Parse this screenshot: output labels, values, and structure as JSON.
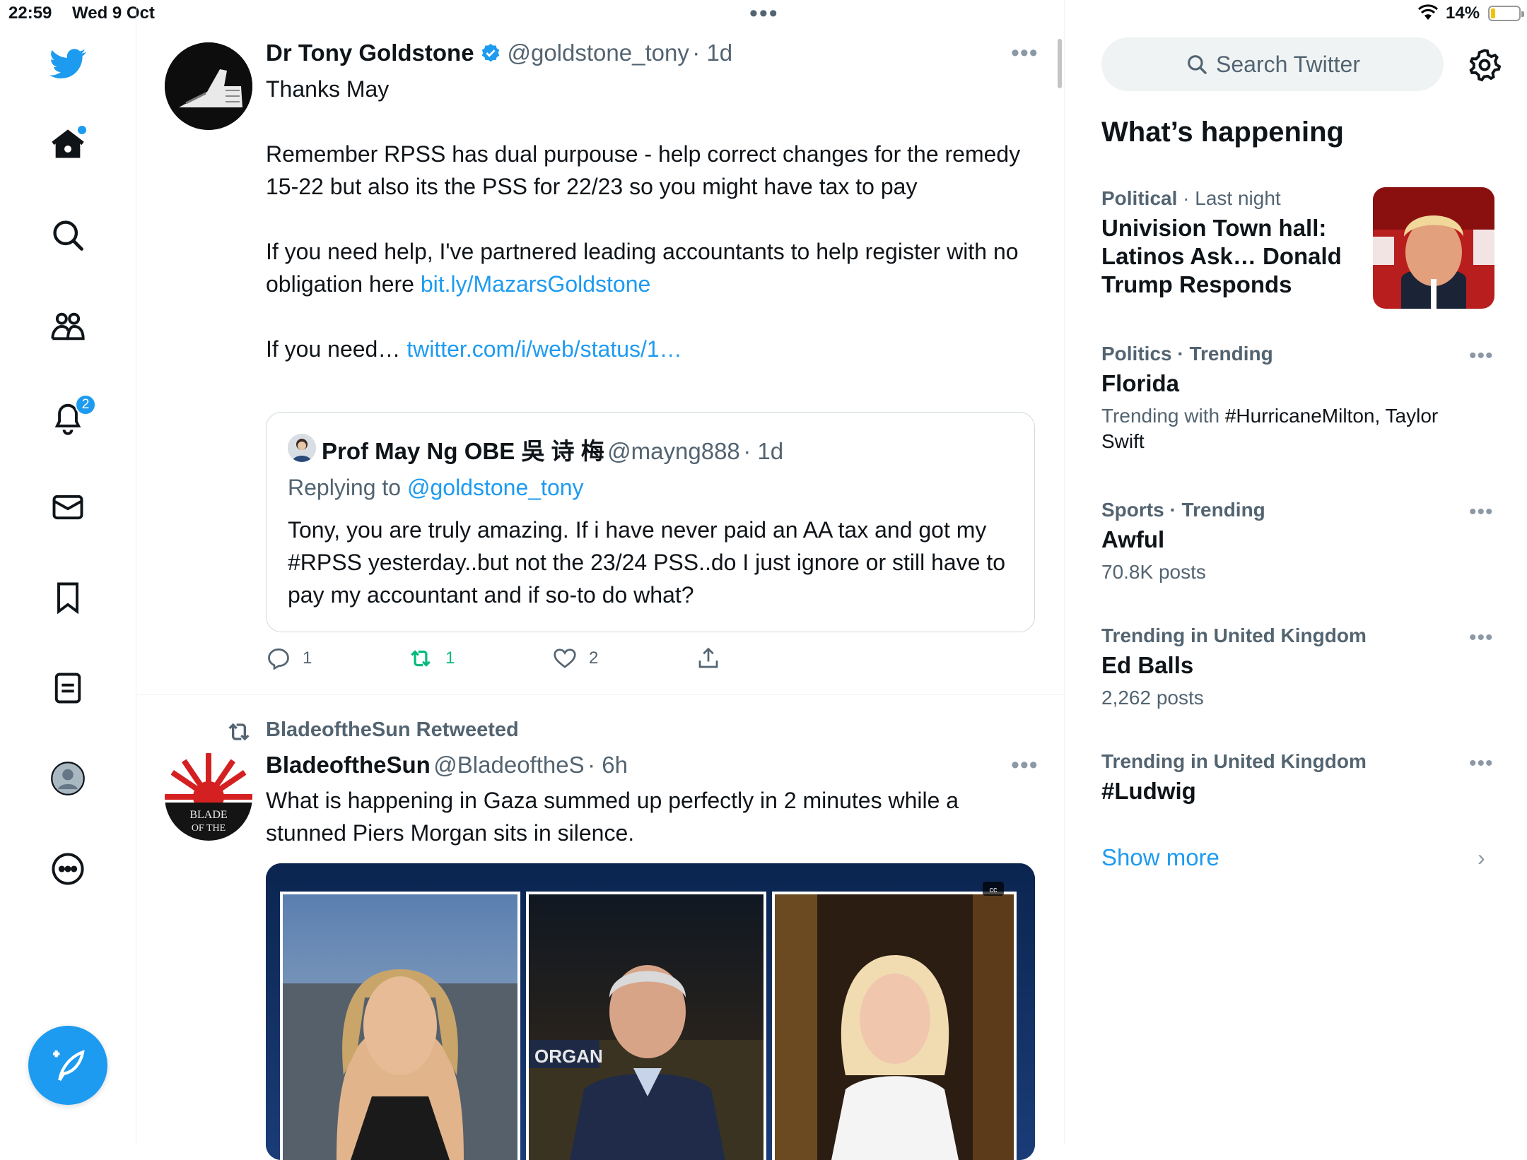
{
  "status_bar": {
    "time": "22:59",
    "date": "Wed 9 Oct",
    "battery": "14%",
    "battery_level": 0.14
  },
  "nav": {
    "items": [
      "home",
      "explore",
      "communities",
      "notifications",
      "messages",
      "bookmarks",
      "lists",
      "profile",
      "more"
    ],
    "notification_count": "2"
  },
  "tweet1": {
    "name": "Dr Tony Goldstone",
    "handle": "@goldstone_tony",
    "time": "· 1d",
    "text_line1": "Thanks May",
    "text_para2": "Remember RPSS has dual purpouse - help correct changes for the remedy 15-22 but also its the PSS for 22/23 so you might have tax to pay",
    "text_para3_prefix": "If you need help, I've partnered leading accountants to help register with no obligation here ",
    "text_para3_link": "bit.ly/MazarsGoldstone",
    "text_para4_prefix": "If you need… ",
    "text_para4_link": "twitter.com/i/web/status/1…",
    "quote": {
      "name": "Prof May Ng OBE 吳 诗 梅",
      "handle": "@mayng888",
      "time": "· 1d",
      "replying_prefix": "Replying to ",
      "replying_handle": "@goldstone_tony",
      "text": "Tony, you are truly amazing. If i have never paid an AA tax and got my #RPSS yesterday..but not the 23/24 PSS..do I just ignore or still have to pay my accountant and if so-to do what?"
    },
    "replies": "1",
    "retweets": "1",
    "likes": "2"
  },
  "tweet2": {
    "retweeted_by": "BladeoftheSun Retweeted",
    "name": "BladeoftheSun",
    "handle": "@BladeoftheS",
    "time": "· 6h",
    "text": "What is happening in Gaza summed up perfectly in 2 minutes while a stunned Piers Morgan sits in silence.",
    "avatar_text_1": "BLADE",
    "avatar_text_2": "OF THE",
    "media_caption": "ORGAN",
    "media_badge": "cc"
  },
  "sidebar": {
    "search_placeholder": "Search Twitter",
    "title": "What’s happening",
    "trends": [
      {
        "category": "Political",
        "meta_rest": " · Last night",
        "title": "Univision Town hall: Latinos Ask… Donald Trump Responds"
      },
      {
        "category": "Politics · Trending",
        "title": "Florida",
        "sub_prefix": "Trending with ",
        "sub_tags": "#HurricaneMilton, Taylor Swift"
      },
      {
        "category": "Sports · Trending",
        "title": "Awful",
        "sub": "70.8K posts"
      },
      {
        "category": "Trending in United Kingdom",
        "title": "Ed Balls",
        "sub": "2,262 posts"
      },
      {
        "category": "Trending in United Kingdom",
        "title": "#Ludwig"
      }
    ],
    "show_more": "Show more"
  },
  "colors": {
    "accent": "#1d9bf0",
    "retweet_green": "#00ba7c",
    "text_secondary": "#536471"
  }
}
